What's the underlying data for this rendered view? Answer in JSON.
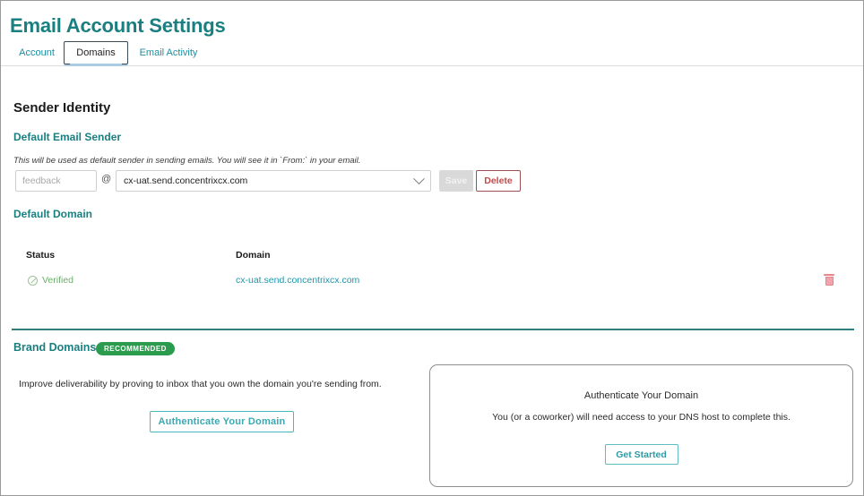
{
  "header": {
    "title": "Email Account Settings"
  },
  "tabs": [
    {
      "label": "Account",
      "active": false
    },
    {
      "label": "Domains",
      "active": true
    },
    {
      "label": "Email Activity",
      "active": false
    }
  ],
  "sender_identity": {
    "section_title": "Sender Identity",
    "sub_title": "Default Email Sender",
    "helper_text": "This will be used as default sender in sending emails. You will see it in `From:` in your email.",
    "local_part_value": "",
    "local_part_placeholder": "feedback",
    "at_symbol": "@",
    "domain_selected": "cx-uat.send.concentrixcx.com",
    "save_label": "Save",
    "delete_label": "Delete"
  },
  "default_domain": {
    "sub_title": "Default Domain",
    "columns": [
      "Status",
      "Domain"
    ],
    "rows": [
      {
        "status": "Verified",
        "domain": "cx-uat.send.concentrixcx.com"
      }
    ]
  },
  "brand_domains": {
    "title": "Brand Domains",
    "badge": "RECOMMENDED",
    "description": "Improve deliverability by proving to inbox that you own the domain you're sending from.",
    "authenticate_label": "Authenticate Your Domain",
    "card": {
      "title": "Authenticate Your Domain",
      "subtitle": "You (or a coworker) will need access to your DNS host to complete this.",
      "button_label": "Get Started"
    }
  },
  "colors": {
    "brand_teal": "#1a7f80",
    "link_teal": "#2196a8",
    "success_green": "#2b9b4d",
    "verified_green": "#6aaf6a",
    "danger_red": "#c24a4a"
  }
}
